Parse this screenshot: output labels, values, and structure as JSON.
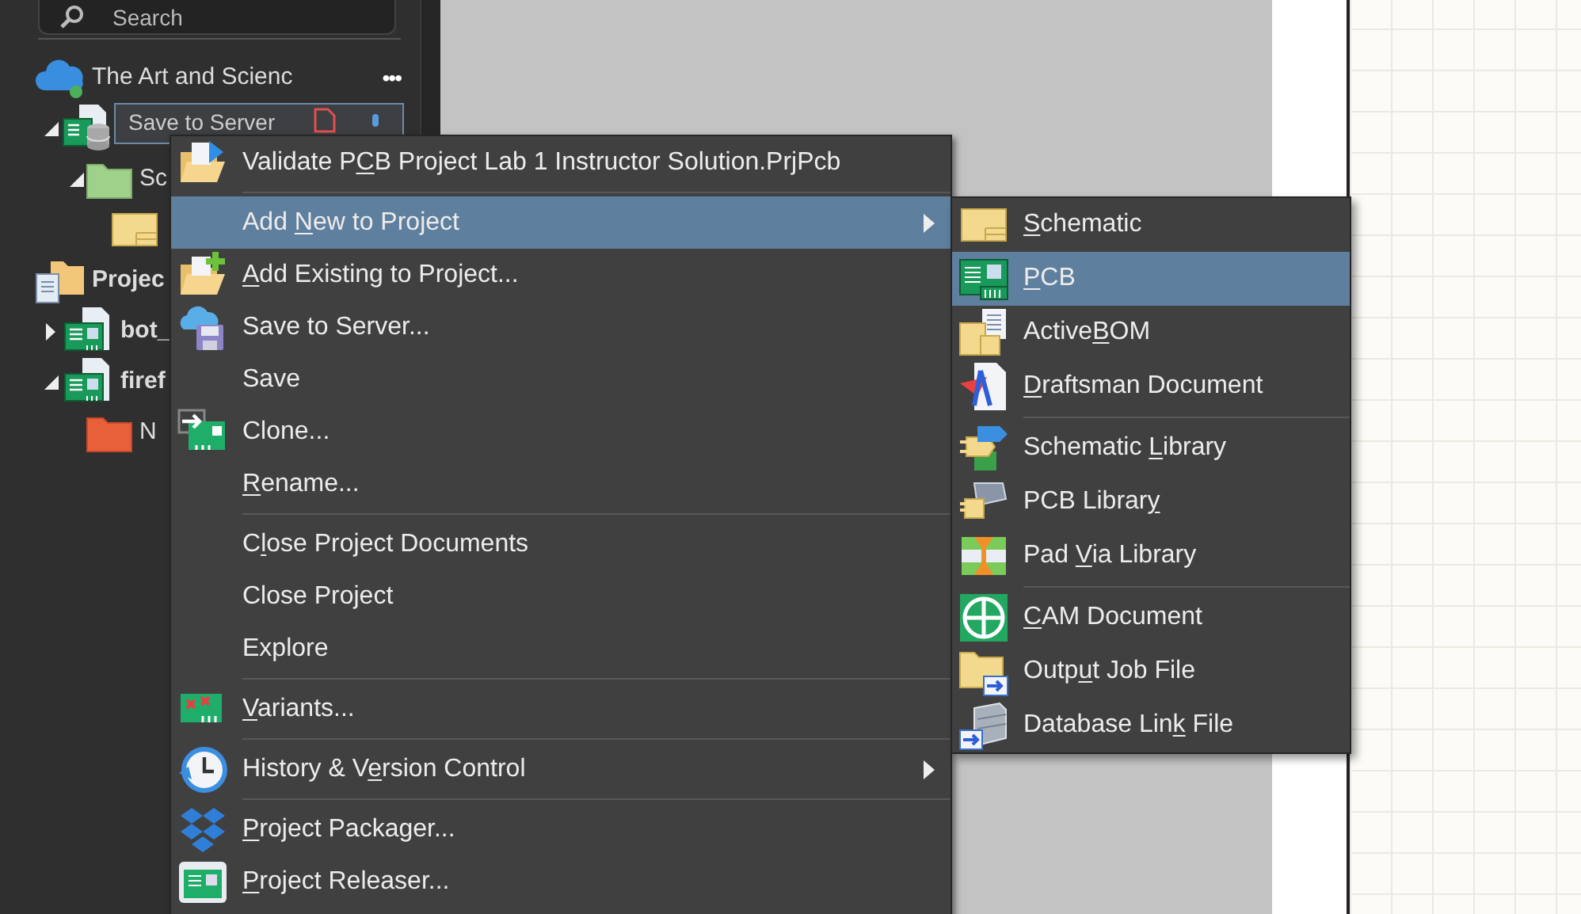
{
  "sidebar": {
    "search": {
      "placeholder": "Search"
    },
    "tree": [
      {
        "kind": "workspace",
        "label": "The Art and Scienc",
        "more": "•••",
        "children": [
          {
            "kind": "project",
            "expanded": true,
            "tooltip": "Save to Server",
            "children": [
              {
                "kind": "source-folder",
                "label": "Sc",
                "expanded": true,
                "children": [
                  {
                    "kind": "schematic"
                  }
                ]
              }
            ]
          }
        ]
      },
      {
        "kind": "group",
        "label": "Projec"
      },
      {
        "kind": "project",
        "label": "bot_",
        "expanded": false
      },
      {
        "kind": "project",
        "label": "firef",
        "expanded": true,
        "children": [
          {
            "kind": "folder",
            "label": "N"
          }
        ]
      }
    ]
  },
  "context_menu": {
    "items": [
      {
        "label": {
          "text": "Validate P",
          "key": "C",
          "rest": "B Project Lab 1 Instructor Solution.PrjPcb"
        },
        "selected": false,
        "has_submenu": false,
        "separator_before": false
      },
      {
        "label": {
          "text": "Add ",
          "key": "N",
          "rest": "ew to Project"
        },
        "selected": true,
        "has_submenu": true,
        "separator_before": true,
        "submenu": [
          {
            "label": {
              "key": "S",
              "rest": "chematic"
            },
            "selected": false,
            "separator_before": false
          },
          {
            "label": {
              "key": "P",
              "rest": "CB"
            },
            "selected": true,
            "separator_before": false
          },
          {
            "label": {
              "text": "Active",
              "key": "B",
              "rest": "OM"
            },
            "selected": false,
            "separator_before": false
          },
          {
            "label": {
              "key": "D",
              "rest": "raftsman Document"
            },
            "selected": false,
            "separator_before": false
          },
          {
            "label": {
              "text": "Schematic ",
              "key": "L",
              "rest": "ibrary"
            },
            "selected": false,
            "separator_before": true
          },
          {
            "label": {
              "text": "PCB Librar",
              "key": "y"
            },
            "selected": false,
            "separator_before": false
          },
          {
            "label": {
              "text": "Pad ",
              "key": "V",
              "rest": "ia Library"
            },
            "selected": false,
            "separator_before": false
          },
          {
            "label": {
              "key": "C",
              "rest": "AM Document"
            },
            "selected": false,
            "separator_before": true
          },
          {
            "label": {
              "text": "Outp",
              "key": "u",
              "rest": "t Job File"
            },
            "selected": false,
            "separator_before": false
          },
          {
            "label": {
              "text": "Database Lin",
              "key": "k",
              "rest": " File"
            },
            "selected": false,
            "separator_before": false
          }
        ]
      },
      {
        "label": {
          "key": "A",
          "rest": "dd Existing to Project..."
        },
        "selected": false,
        "has_submenu": false,
        "separator_before": false
      },
      {
        "label": {
          "text": "Save to Server..."
        },
        "selected": false,
        "has_submenu": false,
        "separator_before": false
      },
      {
        "label": {
          "text": "Save"
        },
        "selected": false,
        "has_submenu": false,
        "separator_before": false
      },
      {
        "label": {
          "text": "Clone..."
        },
        "selected": false,
        "has_submenu": false,
        "separator_before": false
      },
      {
        "label": {
          "key": "R",
          "rest": "ename..."
        },
        "selected": false,
        "has_submenu": false,
        "separator_before": false
      },
      {
        "label": {
          "text": "C",
          "key": "l",
          "rest": "ose Project Documents"
        },
        "selected": false,
        "has_submenu": false,
        "separator_before": true
      },
      {
        "label": {
          "text": "Close Project"
        },
        "selected": false,
        "has_submenu": false,
        "separator_before": false
      },
      {
        "label": {
          "text": "Explore"
        },
        "selected": false,
        "has_submenu": false,
        "separator_before": false
      },
      {
        "label": {
          "key": "V",
          "rest": "ariants..."
        },
        "selected": false,
        "has_submenu": false,
        "separator_before": true
      },
      {
        "label": {
          "text": "History & V",
          "key": "e",
          "rest": "rsion Control"
        },
        "selected": false,
        "has_submenu": true,
        "separator_before": true
      },
      {
        "label": {
          "key": "P",
          "rest": "roject Packager..."
        },
        "selected": false,
        "has_submenu": false,
        "separator_before": true
      },
      {
        "label": {
          "key": "P",
          "rest": "roject Releaser..."
        },
        "selected": false,
        "has_submenu": false,
        "separator_before": false
      }
    ]
  }
}
